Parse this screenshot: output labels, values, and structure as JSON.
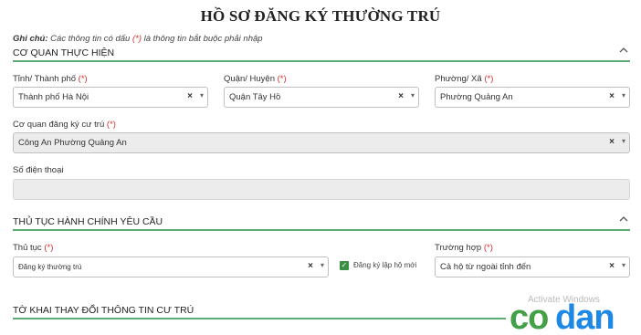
{
  "title": "HỒ SƠ ĐĂNG KÝ THƯỜNG TRÚ",
  "note": {
    "prefix": "Ghi chú:",
    "text_before": " Các thông tin có dấu ",
    "marker": "(*)",
    "text_after": " là thông tin bắt buộc phải nhập"
  },
  "sections": {
    "agency": {
      "label": "CƠ QUAN THỰC HIỆN",
      "collapse_icon": "chevron-up-icon"
    },
    "procedure": {
      "label": "THỦ TỤC HÀNH CHÍNH YÊU CẦU",
      "collapse_icon": "chevron-up-icon"
    },
    "declaration": {
      "label": "TỜ KHAI THAY ĐỔI THÔNG TIN CƯ TRÚ"
    }
  },
  "required_marker": "(*)",
  "fields": {
    "province": {
      "label": "Tỉnh/ Thành phố",
      "value": "Thành phố Hà Nội"
    },
    "district": {
      "label": "Quận/ Huyện",
      "value": "Quận Tây Hồ"
    },
    "ward": {
      "label": "Phường/ Xã",
      "value": "Phường Quảng An"
    },
    "residence_agency": {
      "label": "Cơ quan đăng ký cư trú",
      "value": "Công An Phường Quảng An"
    },
    "phone": {
      "label": "Số điện thoại",
      "value": ""
    },
    "procedure": {
      "label": "Thủ tục",
      "value": "Đăng ký thường trú"
    },
    "new_household": {
      "label": "Đăng ký lập hộ mới",
      "checked": true
    },
    "case": {
      "label": "Trường hợp",
      "value": "Cả hộ từ ngoài tỉnh đến"
    }
  },
  "select_icons": {
    "clear": "×",
    "arrow": "▾"
  },
  "watermark": {
    "line1": "Activate Windows",
    "line2": "Go to Settings to activate Windows."
  },
  "logo": {
    "text": "codan",
    "colors": {
      "green": "#43a047",
      "blue": "#1e88e5"
    }
  },
  "colors": {
    "accent_line": "#5aad72",
    "required": "#d0312d",
    "checkbox": "#3b8f43"
  }
}
